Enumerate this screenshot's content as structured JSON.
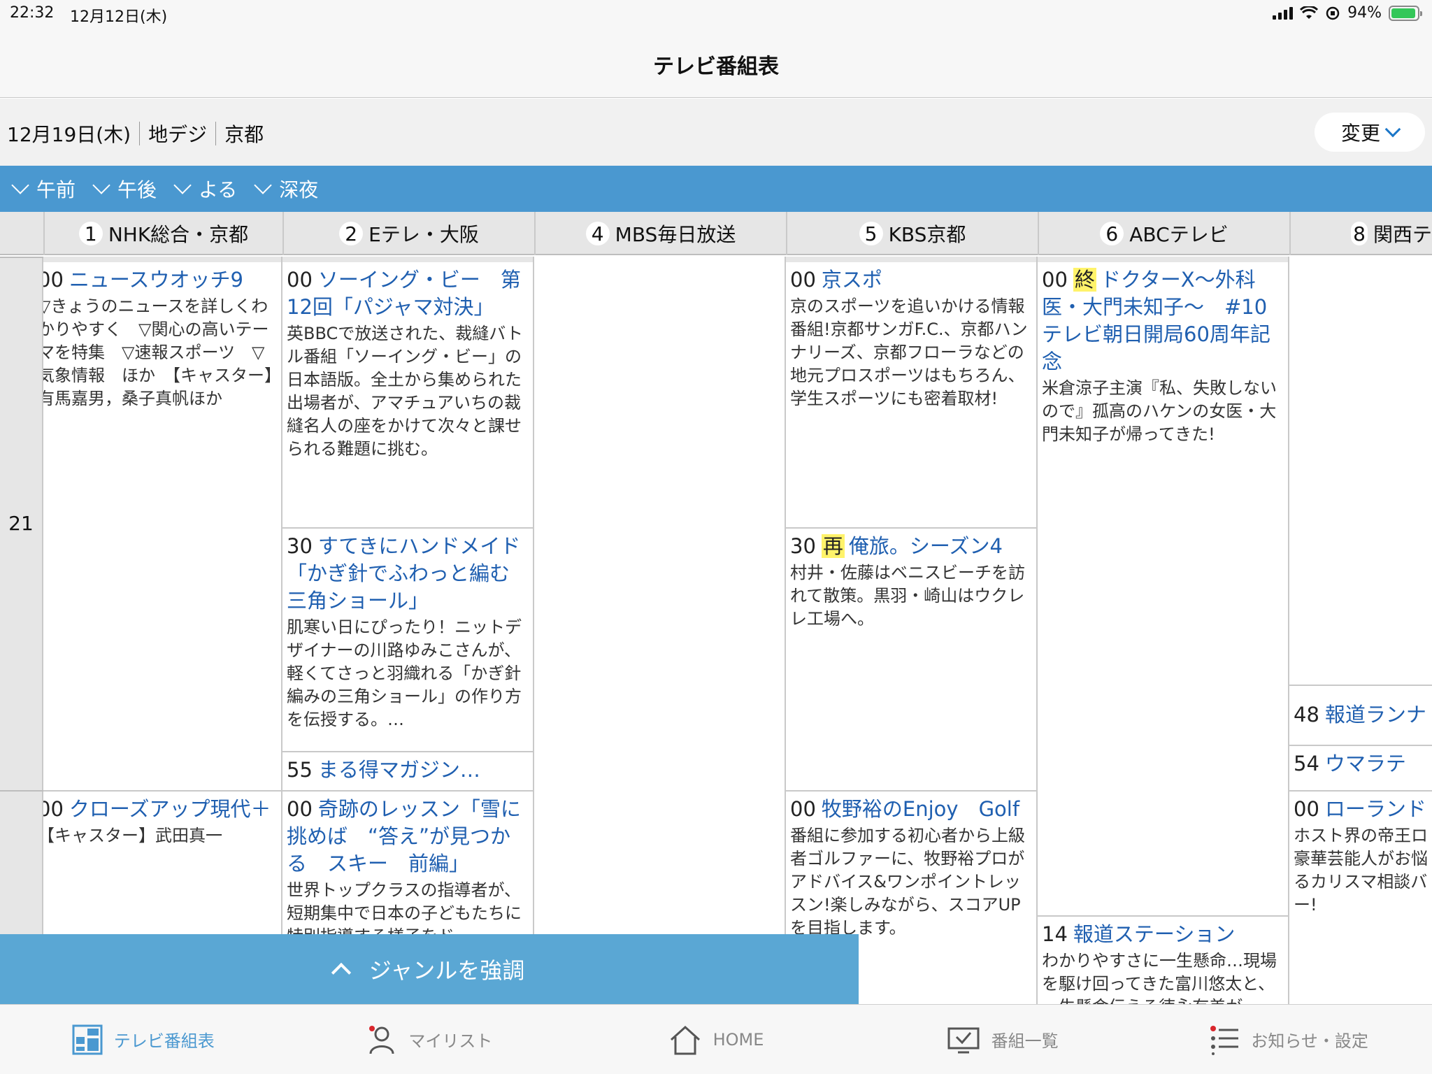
{
  "status": {
    "time": "22:32",
    "date": "12月12日(木)",
    "battery": "94%"
  },
  "nav": {
    "title": "テレビ番組表"
  },
  "filter": {
    "date": "12月19日(木)",
    "broadcast": "地デジ",
    "region": "京都",
    "change_label": "変更"
  },
  "time_tabs": [
    "午前",
    "午後",
    "よる",
    "深夜"
  ],
  "channels": [
    {
      "num": "1",
      "name": "NHK総合・京都"
    },
    {
      "num": "2",
      "name": "Eテレ・大阪"
    },
    {
      "num": "4",
      "name": "MBS毎日放送"
    },
    {
      "num": "5",
      "name": "KBS京都"
    },
    {
      "num": "6",
      "name": "ABCテレビ"
    },
    {
      "num": "8",
      "name": "関西テ"
    }
  ],
  "hours": [
    "21"
  ],
  "programs": {
    "nhk": [
      {
        "min": "00",
        "title": "ニュースウオッチ9",
        "desc": "▽きょうのニュースを詳しくわかりやすく　▽関心の高いテーマを特集　▽速報スポーツ　▽気象情報　ほか　【キャスター】有馬嘉男，桑子真帆ほか"
      },
      {
        "min": "00",
        "title": "クローズアップ現代＋",
        "desc": "【キャスター】武田真一"
      }
    ],
    "etv": [
      {
        "min": "00",
        "title": "ソーイング・ビー　第12回「パジャマ対決」",
        "desc": "英BBCで放送された、裁縫バトル番組「ソーイング・ビー」の日本語版。全土から集められた出場者が、アマチュアいちの裁縫名人の座をかけて次々と課せられる難題に挑む。"
      },
      {
        "min": "30",
        "title": "すてきにハンドメイド「かぎ針でふわっと編む　三角ショール」",
        "desc": "肌寒い日にぴったり！ニットデザイナーの川路ゆみこさんが、軽くてさっと羽織れる「かぎ針編みの三角ショール」の作り方を伝授する。…"
      },
      {
        "min": "55",
        "title": "まる得マガジン…",
        "desc": ""
      },
      {
        "min": "00",
        "title": "奇跡のレッスン「雪に挑めば　“答え”が見つかる　スキー　前編」",
        "desc": "世界トップクラスの指導者が、短期集中で日本の子どもたちに特別指導する様子をド"
      }
    ],
    "kbs": [
      {
        "min": "00",
        "title": "京スポ",
        "desc": "京のスポーツを追いかける情報番組!京都サンガF.C.、京都ハンナリーズ、京都フローラなどの地元プロスポーツはもちろん、学生スポーツにも密着取材!"
      },
      {
        "min": "30",
        "badge": "再",
        "title": "俺旅。シーズン4",
        "desc": "村井・佐藤はベニスビーチを訪れて散策。黒羽・崎山はウクレレ工場へ。"
      },
      {
        "min": "00",
        "title": "牧野裕のEnjoy　Golf",
        "desc": "番組に参加する初心者から上級者ゴルファーに、牧野裕プロがアドバイス&ワンポイントレッスン!楽しみながら、スコアUPを目指します。"
      }
    ],
    "abc": [
      {
        "min": "00",
        "badge": "終",
        "title": "ドクターX～外科医・大門未知子～　#10　テレビ朝日開局60周年記念",
        "desc": "米倉涼子主演『私、失敗しないので』孤高のハケンの女医・大門未知子が帰ってきた!"
      },
      {
        "min": "14",
        "title": "報道ステーション",
        "desc": "わかりやすさに一生懸命…現場を駆け回ってきた富川悠太と、一生懸命伝える徳永有美が"
      }
    ],
    "ktv": [
      {
        "min": "48",
        "title": "報道ランナ",
        "desc": ""
      },
      {
        "min": "54",
        "title": "ウマラテ",
        "desc": ""
      },
      {
        "min": "00",
        "title": "ローランド",
        "desc": "ホスト界の帝王ロ豪華芸能人がお悩るカリスマ相談バー!"
      }
    ]
  },
  "genre_bar": {
    "label": "ジャンルを強調"
  },
  "tabs": [
    {
      "label": "テレビ番組表",
      "icon": "grid-icon"
    },
    {
      "label": "マイリスト",
      "icon": "person-icon"
    },
    {
      "label": "HOME",
      "icon": "home-icon"
    },
    {
      "label": "番組一覧",
      "icon": "tv-icon"
    },
    {
      "label": "お知らせ・設定",
      "icon": "list-icon"
    }
  ],
  "colors": {
    "accent": "#4a98d0",
    "link": "#1f5fb0",
    "badge": "#fff36a"
  }
}
